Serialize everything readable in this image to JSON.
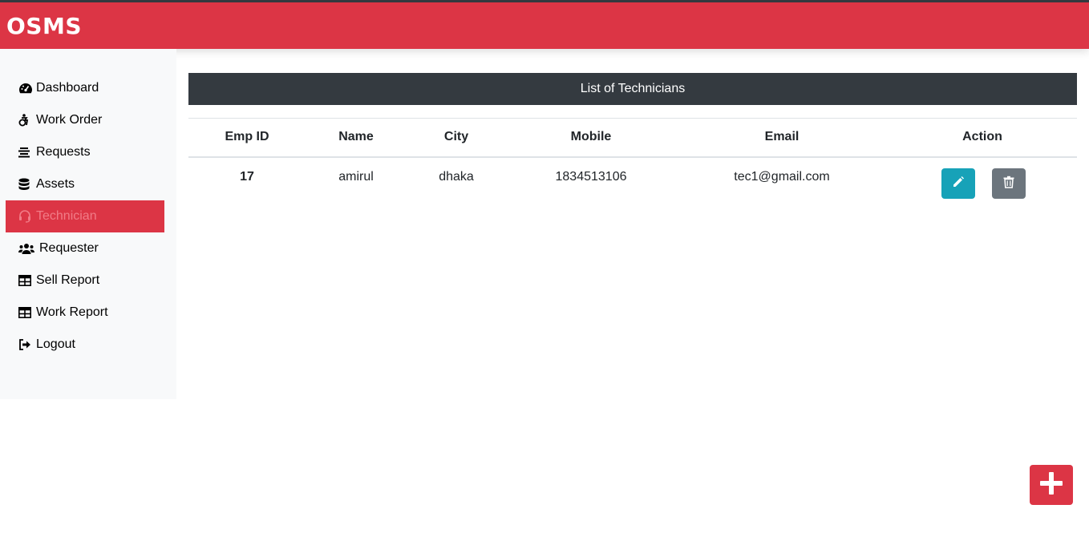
{
  "app": {
    "brand": "OSMS"
  },
  "sidebar": {
    "items": [
      {
        "label": "Dashboard",
        "icon": "tachometer-icon",
        "active": false
      },
      {
        "label": "Work Order",
        "icon": "accessible-icon",
        "active": false
      },
      {
        "label": "Requests",
        "icon": "align-center-icon",
        "active": false
      },
      {
        "label": "Assets",
        "icon": "database-icon",
        "active": false
      },
      {
        "label": "Technician",
        "icon": "headset-icon",
        "active": true
      },
      {
        "label": "Requester",
        "icon": "users-icon",
        "active": false
      },
      {
        "label": "Sell Report",
        "icon": "table-icon",
        "active": false
      },
      {
        "label": "Work Report",
        "icon": "table-icon",
        "active": false
      },
      {
        "label": "Logout",
        "icon": "sign-out-icon",
        "active": false
      }
    ]
  },
  "main": {
    "title": "List of Technicians",
    "columns": [
      "Emp ID",
      "Name",
      "City",
      "Mobile",
      "Email",
      "Action"
    ],
    "rows": [
      {
        "emp_id": "17",
        "name": "amirul",
        "city": "dhaka",
        "mobile": "1834513106",
        "email": "tec1@gmail.com"
      }
    ],
    "actions": {
      "edit_icon": "pencil-icon",
      "delete_icon": "trash-icon"
    },
    "add_button_icon": "plus-icon"
  },
  "colors": {
    "brand_red": "#dc3545",
    "dark_header": "#343a40",
    "edit_teal": "#17a2b8",
    "delete_gray": "#6c757d",
    "sidebar_bg": "#f8f9fa"
  }
}
